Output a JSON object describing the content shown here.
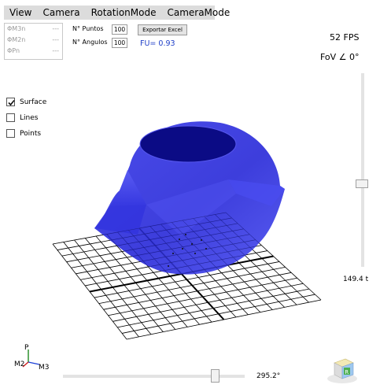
{
  "menu": {
    "items": [
      "View",
      "Camera",
      "RotationMode",
      "CameraMode"
    ]
  },
  "readouts": [
    {
      "label": "ΦM3n",
      "value": "---"
    },
    {
      "label": "ΦM2n",
      "value": "---"
    },
    {
      "label": "ΦPn",
      "value": "---"
    }
  ],
  "params": {
    "puntos_label": "N° Puntos",
    "puntos_value": "100",
    "angulos_label": "N° Angulos",
    "angulos_value": "100",
    "export_button": "Exportar Excel",
    "fu_text": "FU= 0.93"
  },
  "stats": {
    "fps": "52 FPS",
    "fov": "FoV ∠ 0°"
  },
  "display_options": [
    {
      "label": "Surface",
      "checked": true
    },
    {
      "label": "Lines",
      "checked": false
    },
    {
      "label": "Points",
      "checked": false
    }
  ],
  "sliders": {
    "vertical_value": "149.4 t",
    "horizontal_value": "295.2°"
  },
  "axes": {
    "p_label": "P",
    "m2_label": "M2",
    "m3_label": "M3"
  },
  "colors": {
    "surface": "#2a2bd8",
    "surface_dark": "#0a0a7e",
    "grid": "#000000",
    "fu_text": "#1f3fc8"
  },
  "icons": {
    "check": "check-icon",
    "cube": "view-cube-icon"
  }
}
